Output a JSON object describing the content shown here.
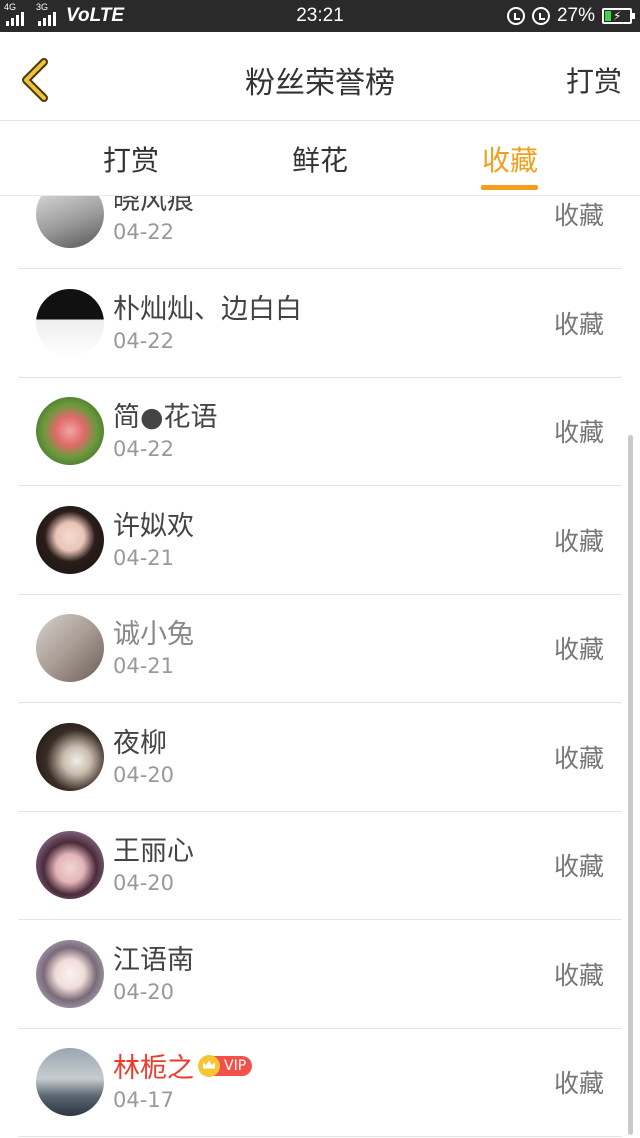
{
  "status_bar": {
    "net1": "4G",
    "net2": "3G",
    "volte": "VoLTE",
    "time": "23:21",
    "battery": "27%",
    "battery_level": 0.27
  },
  "header": {
    "title": "粉丝荣誉榜",
    "right_action": "打赏"
  },
  "tabs": [
    {
      "label": "打赏",
      "active": false
    },
    {
      "label": "鲜花",
      "active": false
    },
    {
      "label": "收藏",
      "active": true
    }
  ],
  "accent_color": "#f0a01e",
  "fans": [
    {
      "name": "晓风痕",
      "date": "04-22",
      "action": "收藏"
    },
    {
      "name": "朴灿灿、边白白",
      "date": "04-22",
      "action": "收藏"
    },
    {
      "name": "简●花语",
      "date": "04-22",
      "action": "收藏"
    },
    {
      "name": "许姒欢",
      "date": "04-21",
      "action": "收藏"
    },
    {
      "name": "诚小兔",
      "date": "04-21",
      "action": "收藏"
    },
    {
      "name": "夜柳",
      "date": "04-20",
      "action": "收藏"
    },
    {
      "name": "王丽心",
      "date": "04-20",
      "action": "收藏"
    },
    {
      "name": "江语南",
      "date": "04-20",
      "action": "收藏"
    },
    {
      "name": "林栀之",
      "date": "04-17",
      "action": "收藏",
      "vip": "VIP"
    }
  ]
}
